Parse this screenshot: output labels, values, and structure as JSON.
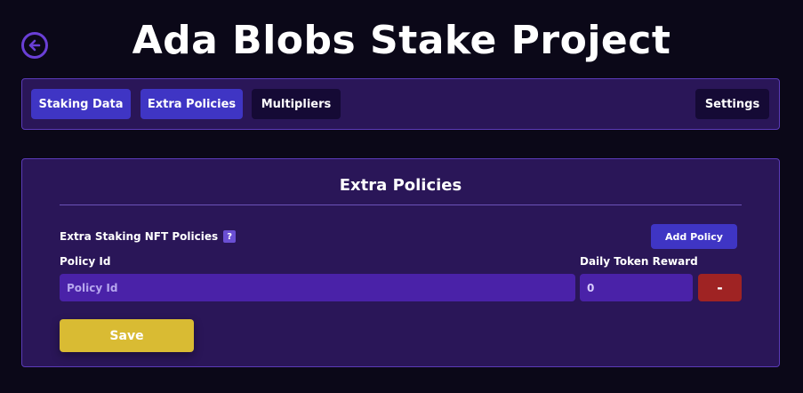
{
  "header": {
    "title": "Ada Blobs Stake Project",
    "back_icon": "arrow-left-circle-icon"
  },
  "nav": {
    "tabs": [
      {
        "label": "Staking Data"
      },
      {
        "label": "Extra Policies"
      },
      {
        "label": "Multipliers"
      }
    ],
    "settings_label": "Settings"
  },
  "panel": {
    "title": "Extra Policies",
    "section_label": "Extra Staking NFT Policies",
    "help_label": "?",
    "add_policy_label": "Add Policy",
    "policy_id_label": "Daily Token Reward",
    "columns": {
      "policy_id": "Policy Id",
      "daily_reward": "Daily Token Reward"
    },
    "row": {
      "policy_id_placeholder": "Policy Id",
      "policy_id_value": "",
      "daily_reward_value": "0",
      "remove_label": "-"
    },
    "save_label": "Save"
  },
  "colors": {
    "background": "#0b0818",
    "panel": "#2a1658",
    "primary_button": "#3f35c4",
    "dark_button": "#150a35",
    "input": "#4a22a8",
    "remove_button": "#9f2323",
    "save_button": "#d9bb33"
  }
}
